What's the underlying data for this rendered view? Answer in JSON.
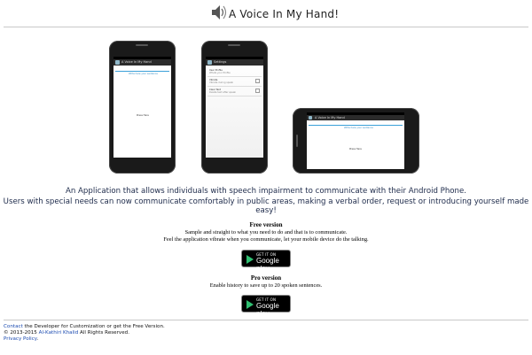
{
  "header": {
    "title": "A Voice In My Hand!"
  },
  "phone_left": {
    "appbar": "A Voice In My Hand",
    "hint": "Write here your sentence",
    "center_text": "Press Here"
  },
  "phone_mid": {
    "appbar": "Settings",
    "rows": [
      {
        "title": "User Profile",
        "sub": "Whats your Profile"
      },
      {
        "title": "Vibrate",
        "sub": "Vibrate during speak"
      },
      {
        "title": "Clear Text",
        "sub": "Delete text after speak"
      }
    ]
  },
  "phone_right": {
    "appbar": "A Voice In My Hand",
    "hint": "Write here your sentence",
    "center_text": "Press Here"
  },
  "description": {
    "line1": "An Application that allows individuals with speech impairment to communicate with their Android Phone.",
    "line2": "Users with special needs can now communicate comfortably in public areas, making a verbal order, request or introducing yourself made easy!"
  },
  "free": {
    "title": "Free version",
    "line1": "Sample and straight to what you need to do and that is to communicate.",
    "line2": "Feel the application vibrate when you communicate, let your mobile device do the talking."
  },
  "pro": {
    "title": "Pro version",
    "line1": "Enable history to save up to 20 spoken sentences."
  },
  "badge": {
    "small": "GET IT ON",
    "big": "Google play"
  },
  "footer": {
    "contact_link": "Contact",
    "contact_rest": " the Developer for Customization or get the Free Version.",
    "copyright_prefix": "© 2013-2015 ",
    "author_link": "Al-Kathiri Khalid",
    "copyright_suffix": " All Rights Reserved.",
    "privacy_link": "Privacy Policy",
    "privacy_dot": "."
  },
  "colors": {
    "accent": "#3aa0d8",
    "link": "#1a4ab0",
    "text_blue": "#1d2a4a",
    "play_green": "#2fbf71"
  },
  "icons": {
    "header": "speaker-icon",
    "badge": "play-triangle-icon"
  }
}
